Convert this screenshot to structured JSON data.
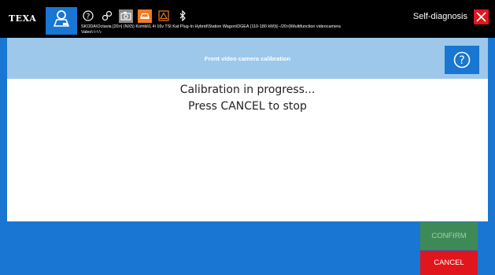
{
  "topbar": {
    "logo": "TEXA",
    "vehicle_line1": "SKODA\\Octavia [20>] (NX5) Kombi\\1.4i 16v TSI Kat Plug-In Hybrid\\Station Wagon\\DGEA (110-180 kW)\\[--/20>]\\Multifunction videocamera",
    "vehicle_line2": "Valeo\\-\\-\\-\\-",
    "mode_label": "Self-diagnosis",
    "icons": [
      "help-circle-icon",
      "link-icon",
      "camera-icon",
      "car-diagnosis-icon",
      "warning-icon",
      "bluetooth-icon"
    ]
  },
  "header": {
    "title": "Front video camera calibration"
  },
  "main": {
    "message_line1": "Calibration in progress...",
    "message_line2": "Press CANCEL to stop"
  },
  "actions": {
    "confirm_label": "CONFIRM",
    "cancel_label": "CANCEL"
  },
  "colors": {
    "accent_blue": "#1976d2",
    "header_light_blue": "#9dc8ea",
    "confirm_green": "#3e8a57",
    "cancel_red": "#e0161c",
    "toolbar_orange": "#f47b20"
  }
}
